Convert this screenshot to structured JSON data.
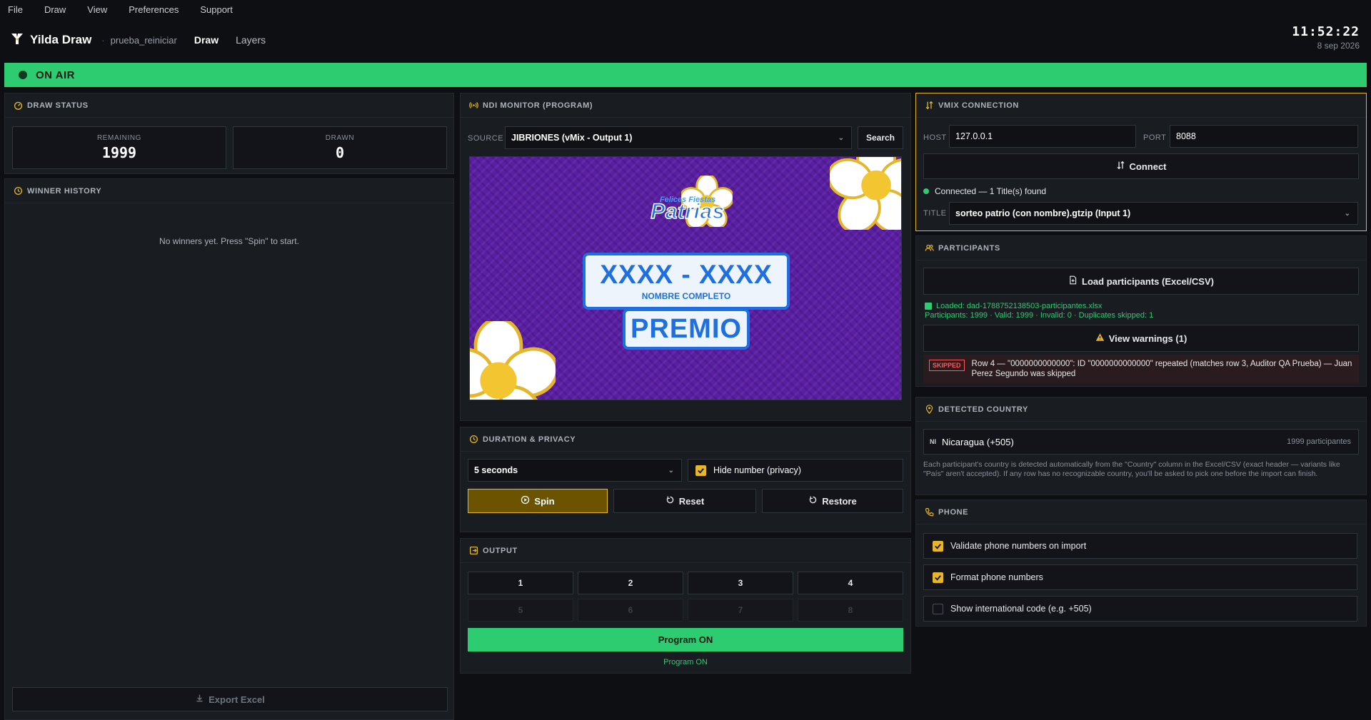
{
  "menu": [
    "File",
    "Draw",
    "View",
    "Preferences",
    "Support"
  ],
  "app": {
    "name": "Yilda Draw",
    "project": "prueba_reiniciar",
    "tabs": [
      "Draw",
      "Layers"
    ]
  },
  "clock": {
    "time": "11:52:22",
    "date": "8 sep 2026"
  },
  "onair": {
    "label": "ON AIR"
  },
  "draw_status": {
    "title": "DRAW STATUS",
    "remaining_label": "REMAINING",
    "remaining": "1999",
    "drawn_label": "DRAWN",
    "drawn": "0"
  },
  "winner_history": {
    "title": "WINNER HISTORY",
    "empty": "No winners yet. Press \"Spin\" to start.",
    "export": "Export Excel"
  },
  "ndi": {
    "title": "NDI MONITOR (PROGRAM)",
    "source_label": "SOURCE",
    "source_value": "JIBRIONES (vMix - Output 1)",
    "search": "Search",
    "preview": {
      "logo_line1": "Felices Fiestas",
      "logo_line2": "Patrias",
      "number": "XXXX - XXXX",
      "name": "NOMBRE COMPLETO",
      "prize": "PREMIO"
    }
  },
  "duration": {
    "title": "DURATION & PRIVACY",
    "value": "5 seconds",
    "hide_number": "Hide number (privacy)",
    "spin": "Spin",
    "reset": "Reset",
    "restore": "Restore"
  },
  "output": {
    "title": "OUTPUT",
    "buttons": [
      "1",
      "2",
      "3",
      "4",
      "5",
      "6",
      "7",
      "8"
    ],
    "program_button": "Program ON",
    "program_status": "Program ON"
  },
  "vmix": {
    "title": "VMIX CONNECTION",
    "host_label": "HOST",
    "host": "127.0.0.1",
    "port_label": "PORT",
    "port": "8088",
    "connect": "Connect",
    "status": "Connected — 1 Title(s) found",
    "title_label": "TITLE",
    "title_value": "sorteo patrio (con nombre).gtzip (Input 1)"
  },
  "participants": {
    "title": "PARTICIPANTS",
    "load": "Load participants (Excel/CSV)",
    "loaded": "Loaded: dad-1788752138503-participantes.xlsx",
    "summary": "Participants: 1999 · Valid: 1999 · Invalid: 0 · Duplicates skipped: 1",
    "warnings": "View warnings (1)",
    "skipped_badge": "SKIPPED",
    "skipped_text": "Row 4 — \"0000000000000\": ID \"0000000000000\" repeated (matches row 3, Auditor QA Prueba) — Juan Perez Segundo was skipped"
  },
  "country": {
    "title": "DETECTED COUNTRY",
    "code": "NI",
    "name": "Nicaragua (+505)",
    "count": "1999 participantes",
    "help": "Each participant's country is detected automatically from the \"Country\" column in the Excel/CSV (exact header — variants like \"País\" aren't accepted). If any row has no recognizable country, you'll be asked to pick one before the import can finish."
  },
  "phone": {
    "title": "PHONE",
    "options": [
      {
        "label": "Validate phone numbers on import",
        "checked": true
      },
      {
        "label": "Format phone numbers",
        "checked": true
      },
      {
        "label": "Show international code (e.g. +505)",
        "checked": false
      }
    ]
  },
  "colors": {
    "accent": "#e5b52a",
    "onair": "#2ecc71",
    "bg": "#0d0f12",
    "panel": "#191c21",
    "preview_bg": "#5a1ea3"
  }
}
